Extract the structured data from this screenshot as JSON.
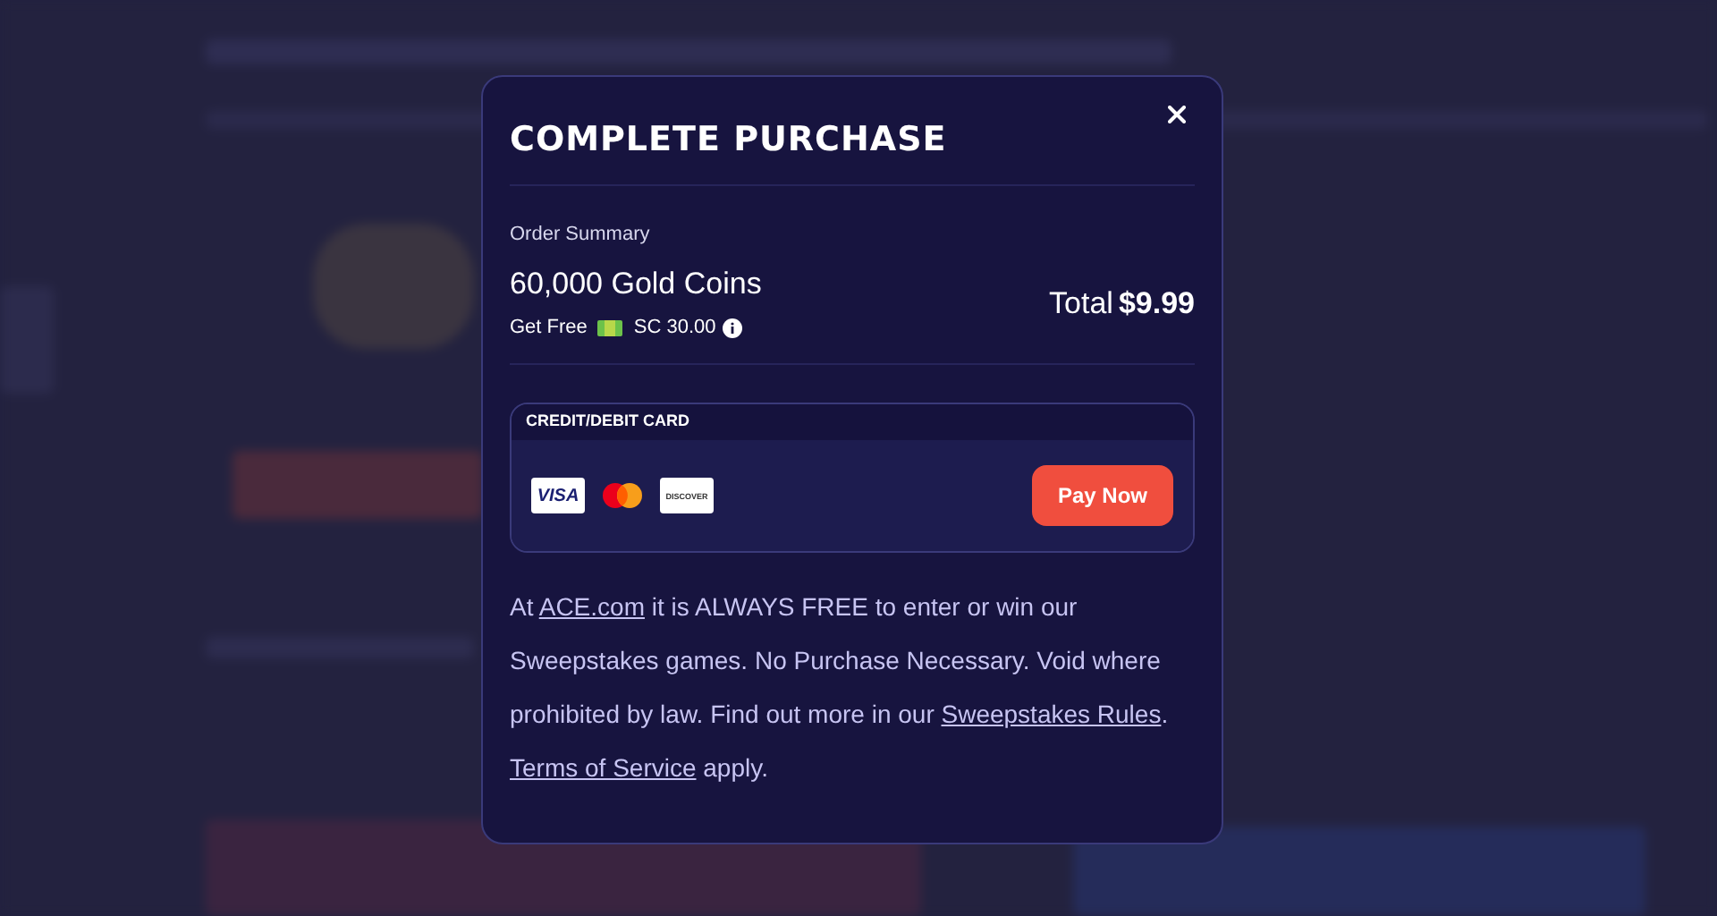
{
  "modal": {
    "title": "COMPLETE PURCHASE",
    "order_summary_label": "Order Summary",
    "product": "60,000 Gold Coins",
    "bonus": {
      "prefix": "Get Free",
      "amount": "SC 30.00"
    },
    "total": {
      "label": "Total",
      "amount": "$9.99"
    },
    "payment": {
      "method_label": "CREDIT/DEBIT CARD",
      "cards": [
        {
          "kind": "visa",
          "label": "VISA"
        },
        {
          "kind": "mastercard"
        },
        {
          "kind": "discover",
          "label": "DISCOVER"
        }
      ],
      "button": "Pay Now"
    },
    "disclaimer": [
      {
        "kind": "text",
        "text": "At "
      },
      {
        "kind": "link",
        "text": "ACE.com"
      },
      {
        "kind": "text",
        "text": " it is ALWAYS FREE to enter or win our Sweepstakes games. No Purchase Necessary. Void where prohibited by law. Find out more in our "
      },
      {
        "kind": "link",
        "text": "Sweepstakes Rules"
      },
      {
        "kind": "text",
        "text": ". "
      },
      {
        "kind": "link",
        "text": "Terms of Service"
      },
      {
        "kind": "text",
        "text": " apply."
      }
    ]
  }
}
